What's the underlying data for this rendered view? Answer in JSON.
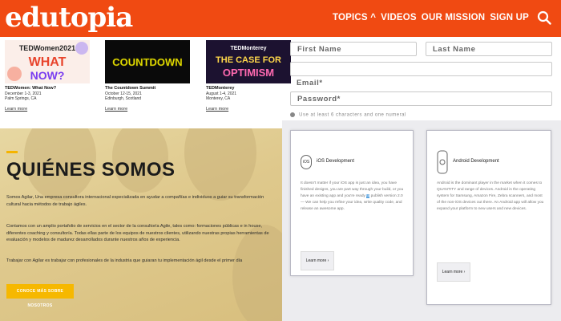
{
  "header": {
    "logo": "edutopia",
    "nav": [
      "TOPICS ^",
      "VIDEOS",
      "OUR MISSION",
      "SIGN UP"
    ],
    "bg_color": "#f04a12"
  },
  "events": [
    {
      "title": "TEDWomen: What Now?",
      "dates": "December 1-3, 2021",
      "place": "Palm Springs, CA",
      "link": "Learn more",
      "thumb_lines": [
        "TEDWomen2021",
        "WHAT",
        "NOW?"
      ]
    },
    {
      "title": "The Countdown Summit",
      "dates": "October 12-15, 2021",
      "place": "Edinburgh, Scotland",
      "link": "Learn more",
      "thumb_lines": [
        "COUNTDOWN"
      ]
    },
    {
      "title": "TEDMonterey",
      "dates": "August 1-4, 2021",
      "place": "Monterey, CA",
      "link": "Learn more",
      "thumb_lines": [
        "TEDMonterey",
        "THE CASE FOR",
        "OPTIMISM"
      ]
    }
  ],
  "form": {
    "first_name": "First Name",
    "last_name": "Last Name",
    "email": "Email*",
    "password": "Password*",
    "hint": "Use at least 6 characters and one numeral"
  },
  "hero": {
    "heading": "QUIÉNES SOMOS",
    "p1": "Somos Agilar, Una empresa consultora internacional especializada en ayudar a compañías e individuos a guiar su transformación cultural hacia métodos de trabajo ágiles.",
    "p2": "Contamos con un amplio portafolio de servicios en el sector de la consultoría Agile, tales como: formaciones públicas e in house, diferentes coaching y consultoría. Todas ellas parte de los equipos de nuestros clientes, utilizando nuestras propias herramientas de evaluación y modelos de madurez desarrollados durante nuestros años de experiencia.",
    "p3": "Trabajar con Agilar es trabajar con profesionales de la industria que guiaran tu implementación ágil desde el primer día",
    "button": "CONOCE MÁS SOBRE NOSOTROS",
    "accent": "#f6b800"
  },
  "cards": [
    {
      "icon": "iOS",
      "title": "iOS Development",
      "body_pre": "It doesn't matter if your iOS app is just an idea, you have finished designs, you are part way through your build, or you have an existing app and you're ready ",
      "body_hl": "to",
      "body_post": "publish version 2.0 — We can help you refine your idea, write quality code, and release an awesome app.",
      "button": "Learn more ›"
    },
    {
      "icon": "android",
      "title": "Android Development",
      "body": "Android is the dominant player in the market when it comes to QUANTITY and range of devices. Android is the operating system for Samsung, Amazon Fire, Zebra scanners, and most of the non-iOS devices out there. An Android app will allow you expand your platform to new users and new devices.",
      "button": "Learn more ›"
    }
  ]
}
